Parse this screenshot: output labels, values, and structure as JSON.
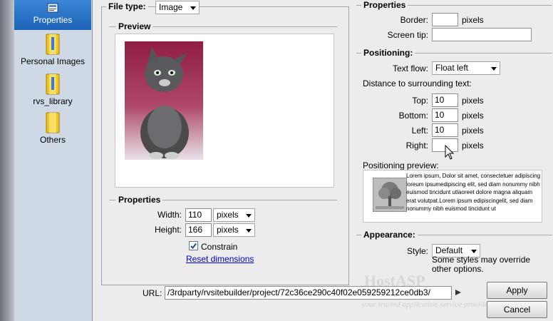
{
  "sidebar": {
    "items": [
      {
        "label": "Properties",
        "icon": "properties-icon"
      },
      {
        "label": "Personal Images",
        "icon": "folder-icon"
      },
      {
        "label": "rvs_library",
        "icon": "folder-icon"
      },
      {
        "label": "Others",
        "icon": "folder-icon"
      }
    ]
  },
  "file_type": {
    "label": "File type:",
    "value": "Image"
  },
  "preview": {
    "legend": "Preview"
  },
  "image_props": {
    "legend": "Properties",
    "width_label": "Width:",
    "width_value": "110",
    "width_unit": "pixels",
    "height_label": "Height:",
    "height_value": "166",
    "height_unit": "pixels",
    "constrain_label": "Constrain",
    "constrain_checked": true,
    "reset_link": "Reset dimensions"
  },
  "url": {
    "label": "URL:",
    "value": "/3rdparty/rvsitebuilder/project/72c36ce290c40f02e059259212ce0db3/"
  },
  "right_props": {
    "legend": "Properties",
    "border_label": "Border:",
    "border_value": "",
    "border_unit": "pixels",
    "tip_label": "Screen tip:",
    "tip_value": ""
  },
  "positioning": {
    "legend": "Positioning:",
    "text_flow_label": "Text flow:",
    "text_flow_value": "Float left",
    "distance_label": "Distance to surrounding text:",
    "top_label": "Top:",
    "top_value": "10",
    "bottom_label": "Bottom:",
    "bottom_value": "10",
    "left_label": "Left:",
    "left_value": "10",
    "right_label": "Right:",
    "right_value": "",
    "unit": "pixels",
    "preview_label": "Positioning preview:",
    "preview_text": "Lorem ipsum, Dolor sit amet, consectetuer adipiscing loreum ipsumedipiscing elit, sed diam nonummy nibh euismod tincidunt utlaoreet dolore magna aliquam erat volutpat.Lorem ipsum edipiscingelit, sed diam nonummy nibh euismod tincidunt ut"
  },
  "appearance": {
    "legend": "Appearance:",
    "style_label": "Style:",
    "style_value": "Default",
    "note": "Some styles may override other options."
  },
  "watermark": {
    "brand": "HostASP",
    "tagline": "your trusted application service provider"
  },
  "buttons": {
    "apply": "Apply",
    "cancel": "Cancel"
  }
}
